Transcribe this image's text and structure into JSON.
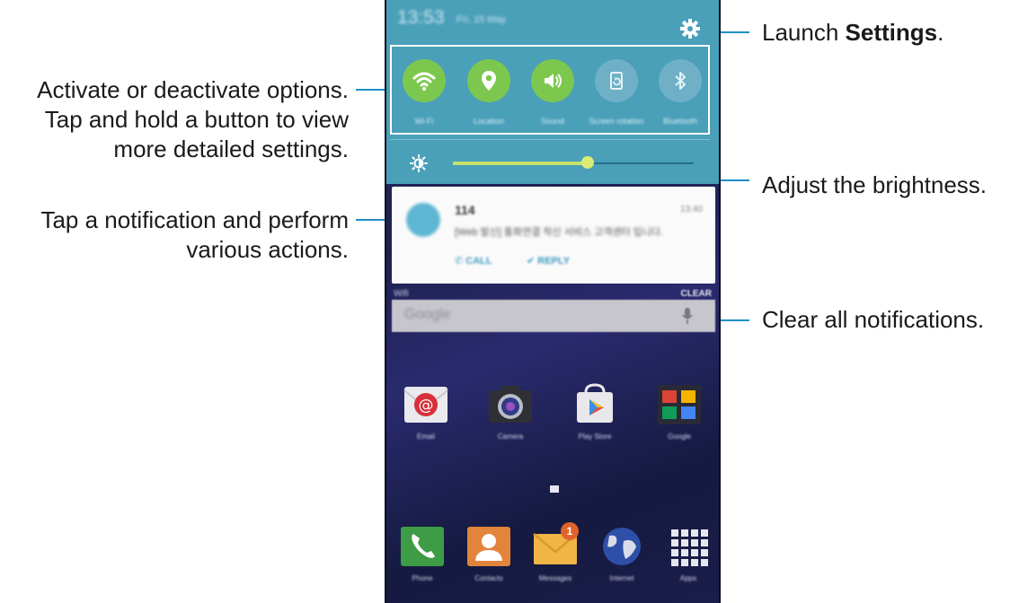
{
  "callouts": {
    "toggles": [
      "Activate or deactivate options.",
      "Tap and hold a button to view",
      "more detailed settings."
    ],
    "notification": [
      "Tap a notification and perform",
      "various actions."
    ],
    "settings_prefix": "Launch ",
    "settings_bold": "Settings",
    "settings_suffix": ".",
    "brightness": "Adjust the brightness.",
    "clear": "Clear all notifications."
  },
  "phone": {
    "status": {
      "time": "13:53",
      "date": "Fri, 15 May"
    },
    "quick_settings": [
      {
        "label": "Wi-Fi",
        "icon": "wifi-icon",
        "state": "on"
      },
      {
        "label": "Location",
        "icon": "location-pin-icon",
        "state": "on"
      },
      {
        "label": "Sound",
        "icon": "speaker-icon",
        "state": "on"
      },
      {
        "label": "Screen rotation",
        "icon": "rotation-icon",
        "state": "off"
      },
      {
        "label": "Bluetooth",
        "icon": "bluetooth-icon",
        "state": "off"
      }
    ],
    "brightness": {
      "level": 0.56
    },
    "notification": {
      "title": "114",
      "time": "13:40",
      "body": "[Web 발신] 통화연결 착신 서비스 고객센터 입니다.",
      "actions": [
        {
          "label": "CALL",
          "icon": "phone-icon"
        },
        {
          "label": "REPLY",
          "icon": "reply-icon"
        }
      ]
    },
    "search": {
      "left_label": "Wifi",
      "clear_label": "CLEAR",
      "placeholder": "Google"
    },
    "apps_row1": [
      {
        "label": "Email",
        "icon": "email-icon"
      },
      {
        "label": "Camera",
        "icon": "camera-icon"
      },
      {
        "label": "Play Store",
        "icon": "play-store-icon"
      },
      {
        "label": "Google",
        "icon": "google-folder-icon"
      }
    ],
    "dock": [
      {
        "label": "Phone",
        "icon": "phone-app-icon"
      },
      {
        "label": "Contacts",
        "icon": "contacts-icon"
      },
      {
        "label": "Messages",
        "icon": "messages-icon",
        "badge": "1"
      },
      {
        "label": "Internet",
        "icon": "internet-icon"
      },
      {
        "label": "Apps",
        "icon": "apps-grid-icon"
      }
    ]
  },
  "colors": {
    "accent_line": "#1f8fc4",
    "toggle_on": "#7cc84e",
    "panel": "#4a9fb9"
  }
}
